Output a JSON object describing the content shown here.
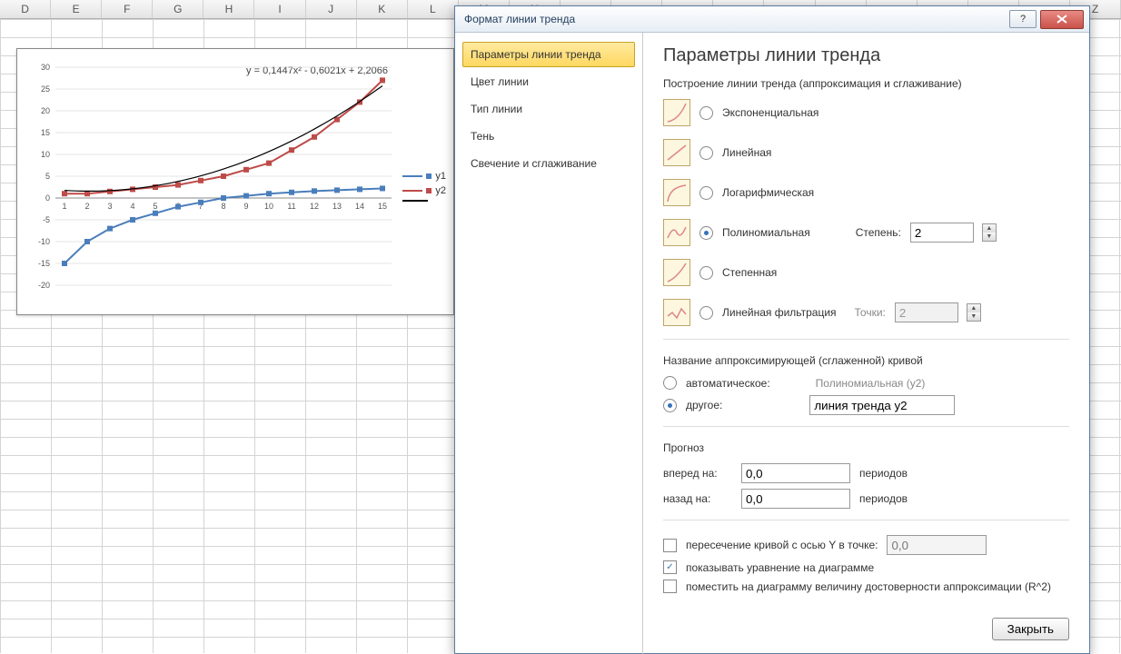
{
  "columns": [
    "D",
    "E",
    "F",
    "G",
    "H",
    "I",
    "J",
    "K",
    "L",
    "M",
    "N",
    "",
    "",
    "",
    "",
    "",
    "",
    "",
    "",
    "",
    "",
    "Z"
  ],
  "chart_data": {
    "type": "line",
    "x": [
      1,
      2,
      3,
      4,
      5,
      6,
      7,
      8,
      9,
      10,
      11,
      12,
      13,
      14,
      15
    ],
    "series": [
      {
        "name": "y1",
        "color": "#4a7ebb",
        "values": [
          -15,
          -10,
          -7,
          -5,
          -3.5,
          -2,
          -1,
          0,
          0.5,
          1,
          1.3,
          1.6,
          1.8,
          2,
          2.2
        ]
      },
      {
        "name": "y2",
        "color": "#be4b48",
        "values": [
          1,
          1,
          1.5,
          2,
          2.5,
          3,
          4,
          5,
          6.5,
          8,
          11,
          14,
          18,
          22,
          27
        ]
      }
    ],
    "trendline": {
      "series": "y2",
      "type": "polynomial",
      "degree": 2,
      "color": "#000",
      "equation": "y = 0,1447x² - 0,6021x + 2,2066"
    },
    "ylim": [
      -20,
      30
    ],
    "ytick": 5,
    "xlim": [
      1,
      15
    ],
    "xtick": 1
  },
  "legend": {
    "y1": "y1",
    "y2": "y2"
  },
  "dialog": {
    "title": "Формат линии тренда",
    "nav": [
      "Параметры линии тренда",
      "Цвет линии",
      "Тип линии",
      "Тень",
      "Свечение и сглаживание"
    ],
    "heading": "Параметры линии тренда",
    "section1": "Построение линии тренда (аппроксимация и сглаживание)",
    "types": {
      "exp": "Экспоненциальная",
      "lin": "Линейная",
      "log": "Логарифмическая",
      "poly": "Полиномиальная",
      "pow": "Степенная",
      "mavg": "Линейная фильтрация"
    },
    "degree_label": "Степень:",
    "degree": "2",
    "points_label": "Точки:",
    "points": "2",
    "name_section": "Название аппроксимирующей (сглаженной) кривой",
    "name_auto": "автоматическое:",
    "name_auto_val": "Полиномиальная (y2)",
    "name_other": "другое:",
    "name_other_val": "линия тренда y2",
    "forecast": "Прогноз",
    "fwd": "вперед на:",
    "fwd_val": "0,0",
    "periods": "периодов",
    "bwd": "назад на:",
    "bwd_val": "0,0",
    "intercept": "пересечение кривой с осью Y в точке:",
    "intercept_val": "0,0",
    "show_eq": "показывать уравнение на диаграмме",
    "show_r2": "поместить на диаграмму величину достоверности аппроксимации (R^2)",
    "close": "Закрыть"
  }
}
